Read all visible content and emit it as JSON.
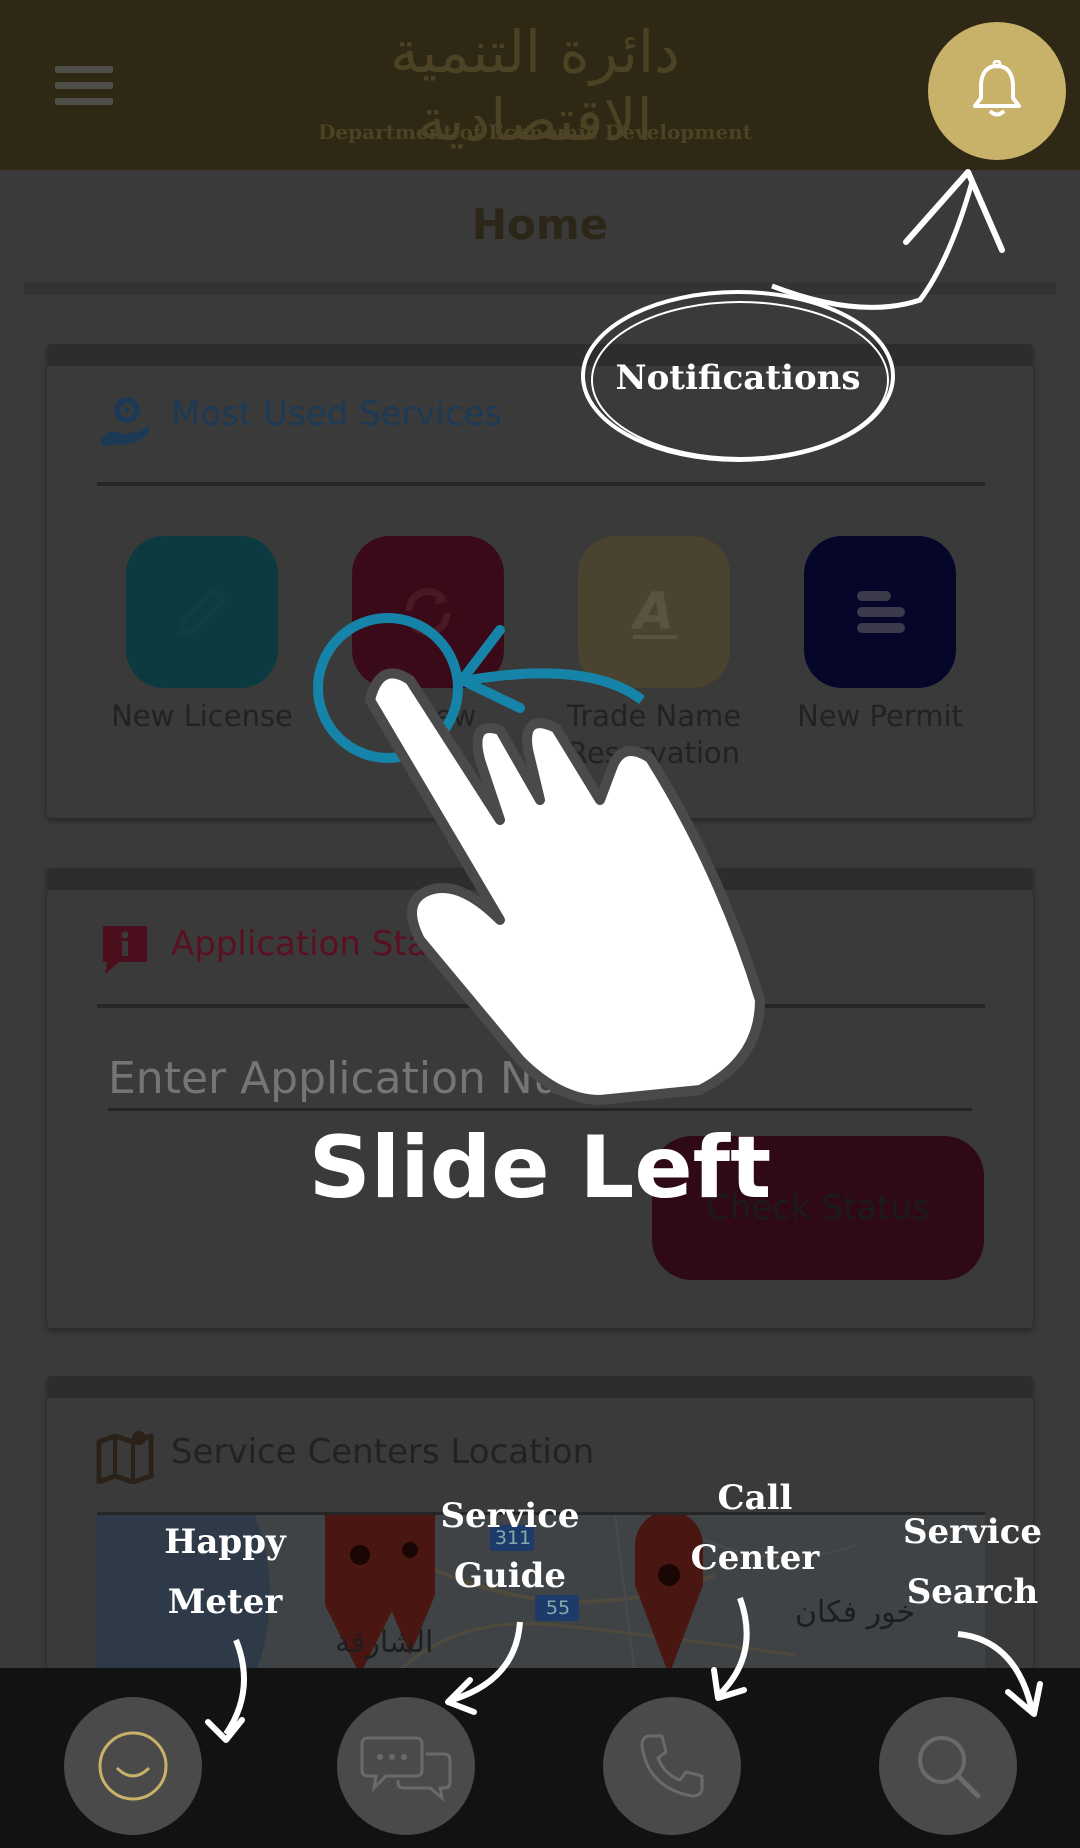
{
  "header": {
    "logo_arabic": "دائرة التنمية الاقتصادية",
    "logo_english": "Department of Economic Development"
  },
  "page": {
    "title": "Home"
  },
  "most_used": {
    "heading": "Most Used Services",
    "services": [
      {
        "label": "New License",
        "icon": "pencil-icon",
        "color": "#0b3a40"
      },
      {
        "label": "Renew",
        "icon": "refresh-icon",
        "color": "#3a0a18"
      },
      {
        "label": "Trade Name Reservation",
        "icon": "letter-a-icon",
        "color": "#4a4330"
      },
      {
        "label": "New Permit",
        "icon": "list-icon",
        "color": "#06062a"
      }
    ]
  },
  "application_status": {
    "heading": "Application Status",
    "input_placeholder": "Enter Application Number",
    "button_label": "Check Status"
  },
  "service_centers": {
    "heading": "Service Centers Location",
    "map_labels": {
      "city_arabic": "الشارقة",
      "town_arabic": "خور فكان",
      "road_1": "311",
      "road_2": "55"
    }
  },
  "bottom_nav": [
    {
      "name": "happy-meter",
      "icon": "smile-icon"
    },
    {
      "name": "service-guide",
      "icon": "chat-icon"
    },
    {
      "name": "call-center",
      "icon": "phone-icon"
    },
    {
      "name": "service-search",
      "icon": "search-icon"
    }
  ],
  "tutorial": {
    "notifications_label": "Notifications",
    "gesture_label": "Slide Left",
    "happy_meter_label": "Happy Meter",
    "service_guide_label": "Service Guide",
    "call_center_label": "Call Center",
    "service_search_label": "Service Search"
  },
  "colors": {
    "header_bg": "#2e2815",
    "bell_accent": "#c8b26a",
    "most_used_heading": "#1c3a55",
    "app_status_heading": "#5a1020",
    "gesture_ring": "#1683a8"
  }
}
